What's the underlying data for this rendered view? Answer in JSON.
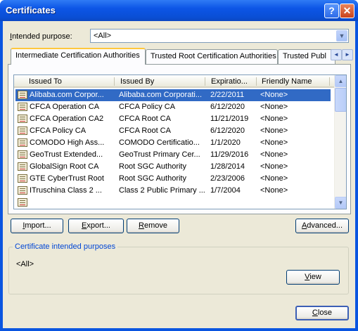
{
  "window": {
    "title": "Certificates",
    "help_glyph": "?",
    "close_glyph": "✕"
  },
  "intended_purpose": {
    "label_underlined": "I",
    "label_rest": "ntended purpose:",
    "value": "<All>"
  },
  "tabs": [
    {
      "label": "Intermediate Certification Authorities",
      "active": true
    },
    {
      "label": "Trusted Root Certification Authorities",
      "active": false
    },
    {
      "label": "Trusted Publ",
      "active": false
    }
  ],
  "tab_scroll": {
    "left": "◄",
    "right": "►"
  },
  "columns": [
    "Issued To",
    "Issued By",
    "Expiratio...",
    "Friendly Name"
  ],
  "rows": [
    {
      "issued_to": "Alibaba.com Corpor...",
      "issued_by": "Alibaba.com Corporati...",
      "expiration": "2/22/2011",
      "friendly_name": "<None>",
      "selected": true
    },
    {
      "issued_to": "CFCA Operation CA",
      "issued_by": "CFCA Policy CA",
      "expiration": "6/12/2020",
      "friendly_name": "<None>"
    },
    {
      "issued_to": "CFCA Operation CA2",
      "issued_by": "CFCA Root CA",
      "expiration": "11/21/2019",
      "friendly_name": "<None>"
    },
    {
      "issued_to": "CFCA Policy CA",
      "issued_by": "CFCA Root CA",
      "expiration": "6/12/2020",
      "friendly_name": "<None>"
    },
    {
      "issued_to": "COMODO High Ass...",
      "issued_by": "COMODO Certificatio...",
      "expiration": "1/1/2020",
      "friendly_name": "<None>"
    },
    {
      "issued_to": "GeoTrust Extended...",
      "issued_by": "GeoTrust Primary Cer...",
      "expiration": "11/29/2016",
      "friendly_name": "<None>"
    },
    {
      "issued_to": "GlobalSign Root CA",
      "issued_by": "Root SGC Authority",
      "expiration": "1/28/2014",
      "friendly_name": "<None>"
    },
    {
      "issued_to": "GTE CyberTrust Root",
      "issued_by": "Root SGC Authority",
      "expiration": "2/23/2006",
      "friendly_name": "<None>"
    },
    {
      "issued_to": "ITruschina Class 2 ...",
      "issued_by": "Class 2 Public Primary ...",
      "expiration": "1/7/2004",
      "friendly_name": "<None>"
    }
  ],
  "scrollbar": {
    "up": "▲",
    "down": "▼"
  },
  "buttons": {
    "import": {
      "u": "I",
      "rest": "mport..."
    },
    "export": {
      "u": "E",
      "rest": "xport..."
    },
    "remove": {
      "u": "R",
      "rest": "emove"
    },
    "advanced": {
      "u": "A",
      "rest": "dvanced..."
    },
    "view": {
      "u": "V",
      "rest": "iew"
    },
    "close": {
      "u": "C",
      "rest": "lose"
    }
  },
  "purposes_group": {
    "label": "Certificate intended purposes",
    "value": "<All>"
  },
  "colors": {
    "selection": "#316ac5",
    "title_bar": "#0a55e0",
    "dialog_face": "#ece9d8",
    "group_label": "#0046d5"
  },
  "icons": [
    "help-icon",
    "close-icon",
    "chevron-down-icon",
    "certificate-icon",
    "scroll-up-icon",
    "scroll-down-icon"
  ]
}
